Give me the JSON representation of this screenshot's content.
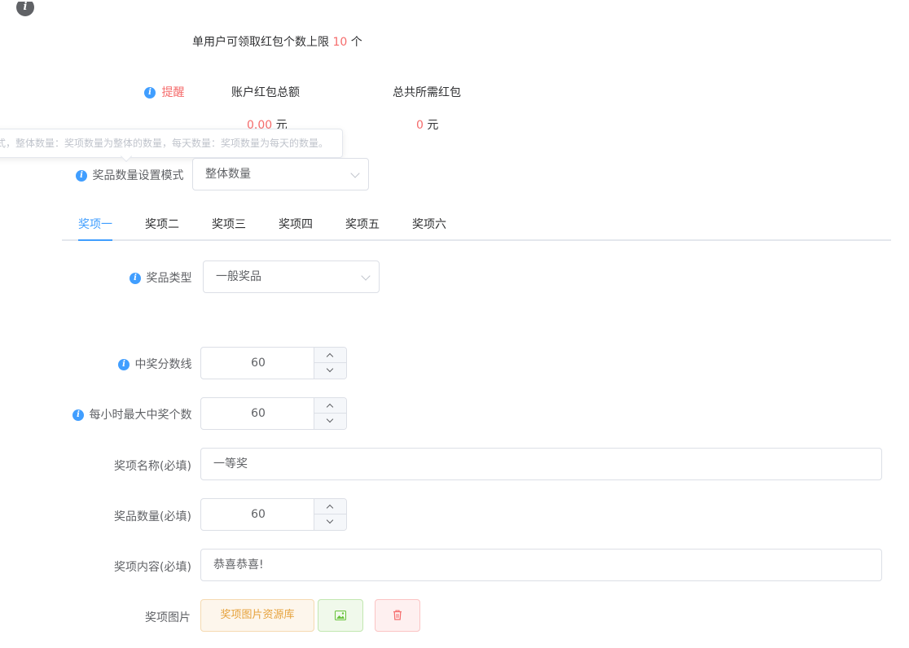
{
  "limit": {
    "prefix": "单用户可领取红包个数上限",
    "value": "10",
    "suffix": "个"
  },
  "reminder": {
    "label": "提醒",
    "account_title": "账户红包总额",
    "account_amount": "0.00",
    "account_unit": "元",
    "required_title": "总共所需红包",
    "required_amount": "0",
    "required_unit": "元"
  },
  "tooltip": {
    "text": "式，整体数量：奖项数量为整体的数量，每天数量：奖项数量为每天的数量。"
  },
  "mode": {
    "label": "奖品数量设置模式",
    "selected": "整体数量"
  },
  "tabs": [
    {
      "label": "奖项一",
      "active": true
    },
    {
      "label": "奖项二",
      "active": false
    },
    {
      "label": "奖项三",
      "active": false
    },
    {
      "label": "奖项四",
      "active": false
    },
    {
      "label": "奖项五",
      "active": false
    },
    {
      "label": "奖项六",
      "active": false
    }
  ],
  "form": {
    "prize_type_label": "奖品类型",
    "prize_type_value": "一般奖品",
    "score_label": "中奖分数线",
    "score_value": "60",
    "hourly_label": "每小时最大中奖个数",
    "hourly_value": "60",
    "name_label": "奖项名称(必填)",
    "name_value": "一等奖",
    "qty_label": "奖品数量(必填)",
    "qty_value": "60",
    "content_label": "奖项内容(必填)",
    "content_value": "恭喜恭喜!",
    "image_label": "奖项图片",
    "library_button": "奖项图片资源库"
  },
  "icons": {
    "info": "info-icon",
    "image": "image-icon",
    "delete": "trash-icon"
  },
  "colors": {
    "primary": "#409eff",
    "danger": "#f56c6c",
    "warning": "#e6a23c",
    "success": "#67c23a"
  }
}
